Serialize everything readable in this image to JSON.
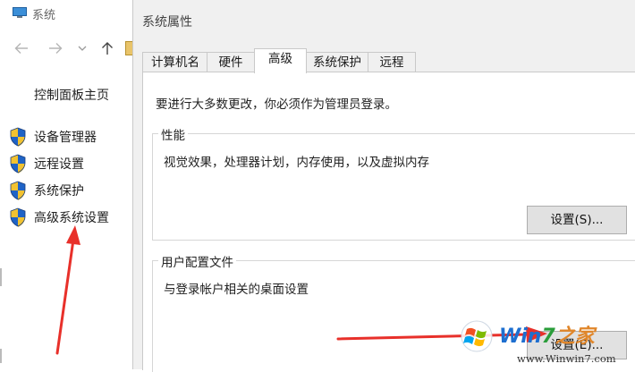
{
  "background_window": {
    "title": "系统",
    "control_panel_home": "控制面板主页",
    "sidebar_items": [
      {
        "label": "设备管理器",
        "icon": "uac-shield-icon"
      },
      {
        "label": "远程设置",
        "icon": "uac-shield-icon"
      },
      {
        "label": "系统保护",
        "icon": "uac-shield-icon"
      },
      {
        "label": "高级系统设置",
        "icon": "uac-shield-icon"
      }
    ]
  },
  "dialog": {
    "title": "系统属性",
    "tabs": [
      {
        "label": "计算机名",
        "active": false
      },
      {
        "label": "硬件",
        "active": false
      },
      {
        "label": "高级",
        "active": true
      },
      {
        "label": "系统保护",
        "active": false
      },
      {
        "label": "远程",
        "active": false
      }
    ],
    "admin_note": "要进行大多数更改，你必须作为管理员登录。",
    "performance": {
      "legend": "性能",
      "description": "视觉效果，处理器计划，内存使用，以及虚拟内存",
      "button": "设置(S)..."
    },
    "user_profiles": {
      "legend": "用户配置文件",
      "description": "与登录帐户相关的桌面设置",
      "button": "设置(E)..."
    }
  },
  "watermark": {
    "brand_a": "Win",
    "brand_b": "7",
    "brand_c": "之家",
    "url": "www.Winwin7.com"
  },
  "colors": {
    "annotation_arrow": "#e8302a",
    "dialog_bg": "#f0f0f0",
    "button_bg": "#e1e1e1"
  }
}
